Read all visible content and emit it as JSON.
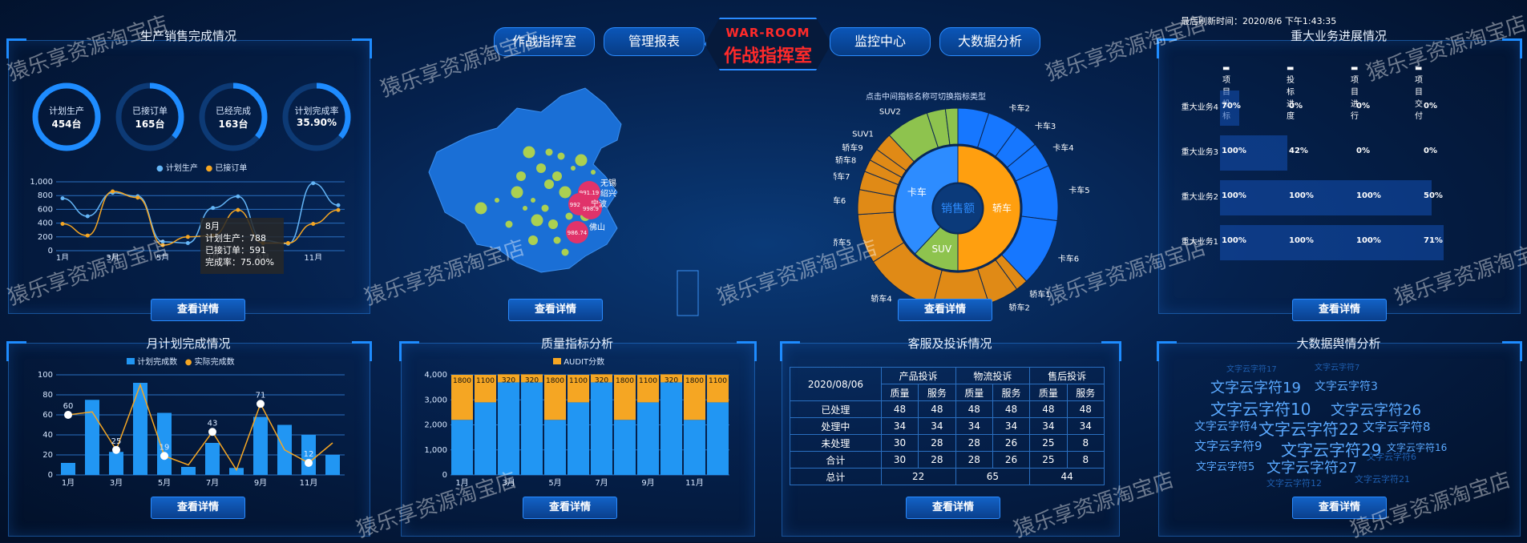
{
  "header": {
    "nav_left": [
      "作战指挥室",
      "管理报表"
    ],
    "nav_right": [
      "监控中心",
      "大数据分析"
    ],
    "center_en": "WAR-ROOM",
    "center_cn": "作战指挥室",
    "refresh": "最后刷新时间：2020/8/6 下午1:43:35"
  },
  "panels": {
    "sales": {
      "title": "生产销售完成情况",
      "btn": "查看详情"
    },
    "map": {
      "btn": "查看详情"
    },
    "sunburst": {
      "hint": "点击中间指标名称可切换指标类型",
      "btn": "查看详情"
    },
    "biz": {
      "title": "重大业务进展情况",
      "btn": "查看详情"
    },
    "monthly": {
      "title": "月计划完成情况",
      "btn": "查看详情"
    },
    "quality": {
      "title": "质量指标分析",
      "btn": "查看详情"
    },
    "service": {
      "title": "客服及投诉情况",
      "btn": "查看详情"
    },
    "bigdata": {
      "title": "大数据舆情分析",
      "btn": "查看详情"
    }
  },
  "rings": [
    {
      "label": "计划生产",
      "value": "454台",
      "pct": 1.0
    },
    {
      "label": "已接订单",
      "value": "165台",
      "pct": 0.36
    },
    {
      "label": "已经完成",
      "value": "163台",
      "pct": 0.36
    },
    {
      "label": "计划完成率",
      "value": "35.90%",
      "pct": 0.36
    }
  ],
  "colors": {
    "blue": "#2196f3",
    "orange": "#f5a623",
    "lightblue": "#64b5f6"
  },
  "watermark": "猿乐享资源淘宝店",
  "chart_data": [
    {
      "type": "line",
      "id": "sales",
      "categories": [
        "1月",
        "2月",
        "3月",
        "4月",
        "5月",
        "6月",
        "7月",
        "8月",
        "9月",
        "10月",
        "11月",
        "12月"
      ],
      "tick_labels": [
        "1月",
        "3月",
        "5月",
        "7月",
        "9月",
        "11月"
      ],
      "series": [
        {
          "name": "计划生产",
          "values": [
            760,
            500,
            840,
            790,
            130,
            110,
            620,
            788,
            150,
            100,
            980,
            660
          ]
        },
        {
          "name": "已接订单",
          "values": [
            390,
            220,
            860,
            770,
            80,
            200,
            220,
            591,
            110,
            110,
            390,
            590
          ]
        }
      ],
      "ylim": [
        0,
        1000
      ],
      "yticks": [
        "0",
        "200",
        "400",
        "600",
        "800",
        "1,000"
      ],
      "tooltip": {
        "month": "8月",
        "plan": "计划生产：788",
        "order": "已接订单：591",
        "rate": "完成率：75.00%"
      }
    },
    {
      "type": "sunburst",
      "id": "sales-mix",
      "center": "销售额",
      "inner": [
        {
          "name": "卡车",
          "value": 38
        },
        {
          "name": "轿车",
          "value": 50
        },
        {
          "name": "SUV",
          "value": 12
        }
      ],
      "outer": [
        {
          "name": "卡车1",
          "value": 5,
          "parent": "卡车"
        },
        {
          "name": "卡车2",
          "value": 5,
          "parent": "卡车"
        },
        {
          "name": "卡车3",
          "value": 4,
          "parent": "卡车"
        },
        {
          "name": "卡车4",
          "value": 4,
          "parent": "卡车"
        },
        {
          "name": "卡车5",
          "value": 9,
          "parent": "卡车"
        },
        {
          "name": "卡车6",
          "value": 11,
          "parent": "卡车"
        },
        {
          "name": "轿车1",
          "value": 2,
          "parent": "轿车"
        },
        {
          "name": "轿车2",
          "value": 5,
          "parent": "轿车"
        },
        {
          "name": "轿车3",
          "value": 9,
          "parent": "轿车"
        },
        {
          "name": "轿车4",
          "value": 12,
          "parent": "轿车"
        },
        {
          "name": "轿车5",
          "value": 8,
          "parent": "轿车"
        },
        {
          "name": "轿车6",
          "value": 4,
          "parent": "轿车"
        },
        {
          "name": "轿车7",
          "value": 3,
          "parent": "轿车"
        },
        {
          "name": "轿车8",
          "value": 2,
          "parent": "轿车"
        },
        {
          "name": "轿车9",
          "value": 2,
          "parent": "轿车"
        },
        {
          "name": "SUV1",
          "value": 3,
          "parent": "轿车"
        },
        {
          "name": "SUV2",
          "value": 7,
          "parent": "SUV"
        },
        {
          "name": "SUV3",
          "value": 3,
          "parent": "SUV"
        },
        {
          "name": "SUV4",
          "value": 2,
          "parent": "SUV"
        }
      ]
    },
    {
      "type": "bar",
      "id": "major-business",
      "legend": [
        "项目投标",
        "投标进度",
        "项目进行",
        "项目交付"
      ],
      "rows": [
        {
          "name": "重大业务4",
          "values": [
            "70%",
            "0%",
            "0%",
            "0%"
          ],
          "progress": 0.08
        },
        {
          "name": "重大业务3",
          "values": [
            "100%",
            "42%",
            "0%",
            "0%"
          ],
          "progress": 0.28
        },
        {
          "name": "重大业务2",
          "values": [
            "100%",
            "100%",
            "100%",
            "50%"
          ],
          "progress": 0.88
        },
        {
          "name": "重大业务1",
          "values": [
            "100%",
            "100%",
            "100%",
            "71%"
          ],
          "progress": 0.93
        }
      ]
    },
    {
      "type": "bar",
      "id": "monthly",
      "categories": [
        "1月",
        "2月",
        "3月",
        "4月",
        "5月",
        "6月",
        "7月",
        "8月",
        "9月",
        "10月",
        "11月",
        "12月"
      ],
      "tick_labels": [
        "1月",
        "3月",
        "5月",
        "7月",
        "9月",
        "11月"
      ],
      "series": [
        {
          "name": "计划完成数",
          "values": [
            12,
            75,
            23,
            92,
            62,
            8,
            32,
            7,
            58,
            50,
            40,
            20
          ]
        },
        {
          "name": "实际完成数",
          "values": [
            60,
            63,
            25,
            90,
            19,
            10,
            43,
            5,
            71,
            25,
            12,
            32
          ]
        }
      ],
      "point_labels": [
        {
          "i": 0,
          "text": "60"
        },
        {
          "i": 2,
          "text": "25"
        },
        {
          "i": 4,
          "text": "19"
        },
        {
          "i": 6,
          "text": "43"
        },
        {
          "i": 8,
          "text": "71"
        },
        {
          "i": 10,
          "text": "12"
        }
      ],
      "ylim": [
        0,
        100
      ],
      "yticks": [
        "0",
        "20",
        "40",
        "60",
        "80",
        "100"
      ]
    },
    {
      "type": "bar",
      "id": "quality",
      "categories": [
        "1月",
        "2月",
        "3月",
        "4月",
        "5月",
        "6月",
        "7月",
        "8月",
        "9月",
        "10月",
        "11月",
        "12月"
      ],
      "tick_labels": [
        "1月",
        "3月",
        "5月",
        "7月",
        "9月",
        "11月"
      ],
      "legend": "AUDIT分数",
      "base": [
        2200,
        2900,
        3700,
        3700,
        2200,
        2900,
        3700,
        2200,
        2900,
        3700,
        2200,
        2900
      ],
      "audit": [
        1800,
        1100,
        320,
        320,
        1800,
        1100,
        320,
        1800,
        1100,
        320,
        1800,
        1100
      ],
      "ylim": [
        0,
        4000
      ],
      "yticks": [
        "0",
        "1,000",
        "2,000",
        "3,000",
        "4,000"
      ]
    },
    {
      "type": "table",
      "id": "complaints",
      "date": "2020/08/06",
      "groups": [
        "产品投诉",
        "物流投诉",
        "售后投诉"
      ],
      "sub": [
        "质量",
        "服务",
        "质量",
        "服务",
        "质量",
        "服务"
      ],
      "rows": [
        {
          "label": "已处理",
          "values": [
            "48",
            "48",
            "48",
            "48",
            "48",
            "48"
          ]
        },
        {
          "label": "处理中",
          "values": [
            "34",
            "34",
            "34",
            "34",
            "34",
            "34"
          ]
        },
        {
          "label": "未处理",
          "values": [
            "30",
            "28",
            "28",
            "26",
            "25",
            "8"
          ]
        },
        {
          "label": "合计",
          "values": [
            "30",
            "28",
            "28",
            "26",
            "25",
            "8"
          ]
        }
      ],
      "total": {
        "label": "总计",
        "values": [
          "22",
          "65",
          "44"
        ]
      }
    }
  ],
  "map_markers": [
    "991.19",
    "992.97",
    "998.9",
    "986.74"
  ],
  "map_labels": [
    "无锡",
    "绍兴",
    "宁波",
    "佛山"
  ],
  "wordcloud": [
    "文字云字符19",
    "文字云字符3",
    "文字云字符10",
    "文字云字符26",
    "文字云字符4",
    "文字云字符22",
    "文字云字符8",
    "文字云字符9",
    "文字云字符29",
    "文字云字符5",
    "文字云字符27",
    "文字云字符16",
    "文字云字符6",
    "文字云字符12",
    "文字云字符21",
    "文字云字符17",
    "文字云字符7"
  ]
}
